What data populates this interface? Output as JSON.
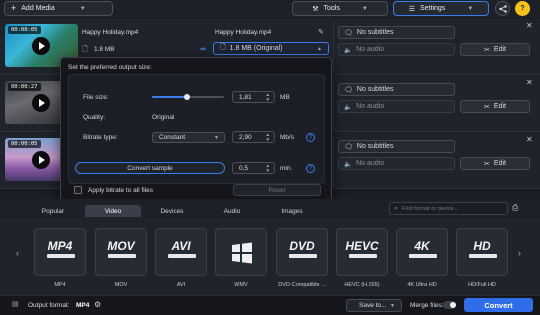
{
  "toolbar": {
    "add_media": "Add Media",
    "tools": "Tools",
    "settings": "Settings",
    "help": "?"
  },
  "files": [
    {
      "duration": "00:00:05",
      "source_name": "Happy Holiday.mp4",
      "source_size": "1.8 MB",
      "output_name": "Happy Holiday.mp4",
      "output_size": "1.8 MB (Original)",
      "subtitles": "No subtitles",
      "audio": "No audio",
      "edit": "Edit"
    },
    {
      "duration": "00:00:27",
      "subtitles": "No subtitles",
      "audio": "No audio",
      "edit": "Edit"
    },
    {
      "duration": "00:00:05",
      "subtitles": "No subtitles",
      "audio": "No audio",
      "edit": "Edit"
    }
  ],
  "popup": {
    "heading": "Set the preferred output size:",
    "file_size_label": "File size:",
    "file_size_value": "1,81",
    "file_size_unit": "MB",
    "file_size_slider": 0.48,
    "quality_label": "Quality:",
    "quality_value": "Original",
    "bitrate_type_label": "Bitrate type:",
    "bitrate_type_value": "Constant",
    "bitrate_value": "2,90",
    "bitrate_unit": "Mb/s",
    "convert_sample": "Convert sample",
    "sample_value": "0,5",
    "sample_unit": "min.",
    "apply_all": "Apply bitrate to all files",
    "reset": "Reset"
  },
  "tabs": [
    "Popular",
    "Video",
    "Devices",
    "Audio",
    "Images"
  ],
  "active_tab": "Video",
  "search_placeholder": "Find format or device...",
  "formats": [
    {
      "big": "MP4",
      "label": "MP4"
    },
    {
      "big": "MOV",
      "label": "MOV"
    },
    {
      "big": "AVI",
      "label": "AVI"
    },
    {
      "big": "",
      "label": "WMV"
    },
    {
      "big": "DVD",
      "label": "DVD-Compatible ..."
    },
    {
      "big": "HEVC",
      "label": "HEVC (H.265)"
    },
    {
      "big": "4K",
      "label": "4K Ultra HD"
    },
    {
      "big": "HD",
      "label": "HD/Full HD"
    }
  ],
  "footer": {
    "output_format_label": "Output format:",
    "output_format_value": "MP4",
    "save_to": "Save to...",
    "merge_files": "Merge files:",
    "convert": "Convert"
  },
  "colors": {
    "accent": "#3b7cf0",
    "convert": "#2f6ee8",
    "help": "#f4c21a"
  }
}
